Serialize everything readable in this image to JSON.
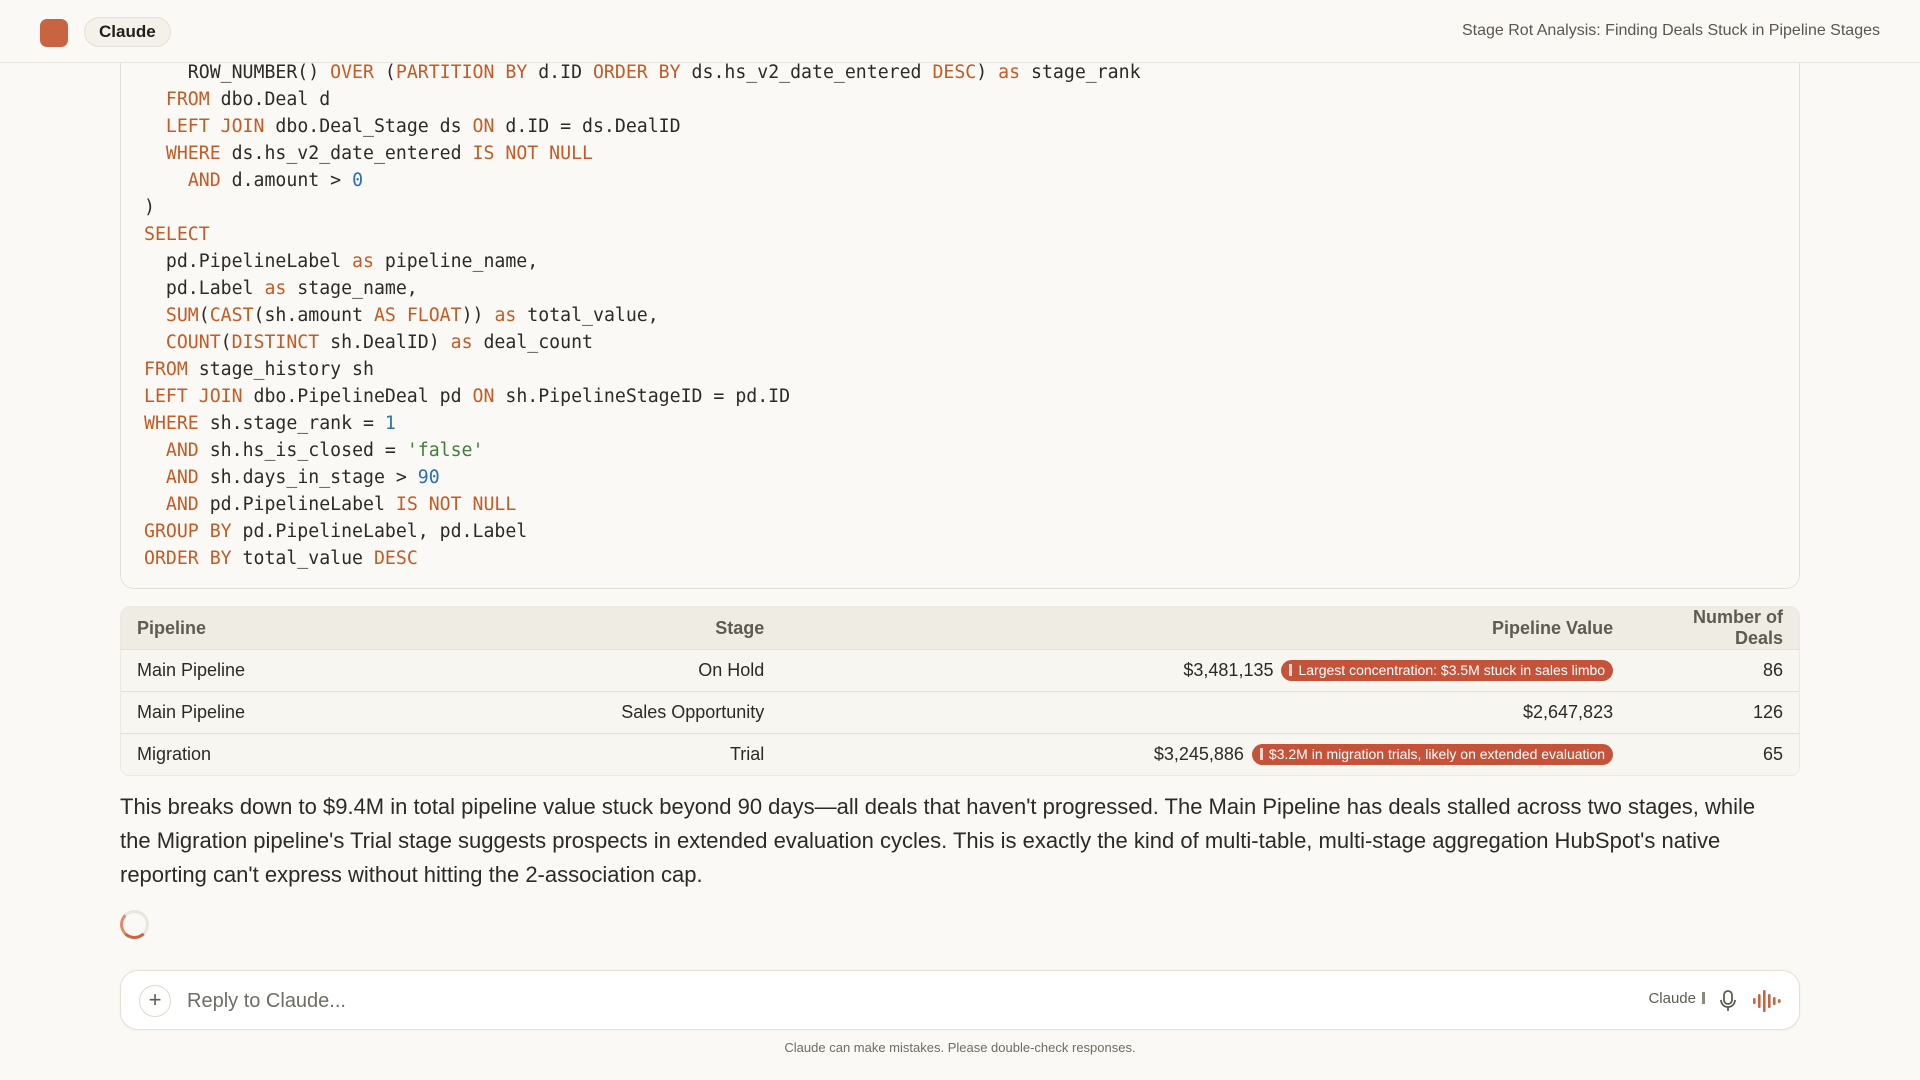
{
  "header": {
    "app_name": "Claude",
    "chat_title": "Stage Rot Analysis: Finding Deals Stuck in Pipeline Stages"
  },
  "code_lines": [
    [
      {
        "t": "    ROW_NUMBER() ",
        "c": ""
      },
      {
        "t": "OVER",
        "c": "kw"
      },
      {
        "t": " (",
        "c": ""
      },
      {
        "t": "PARTITION BY",
        "c": "kw"
      },
      {
        "t": " d.ID ",
        "c": ""
      },
      {
        "t": "ORDER BY",
        "c": "kw"
      },
      {
        "t": " ds.hs_v2_date_entered ",
        "c": ""
      },
      {
        "t": "DESC",
        "c": "kw"
      },
      {
        "t": ") ",
        "c": ""
      },
      {
        "t": "as",
        "c": "kw"
      },
      {
        "t": " stage_rank",
        "c": ""
      }
    ],
    [
      {
        "t": "  ",
        "c": ""
      },
      {
        "t": "FROM",
        "c": "kw"
      },
      {
        "t": " dbo.Deal d",
        "c": ""
      }
    ],
    [
      {
        "t": "  ",
        "c": ""
      },
      {
        "t": "LEFT JOIN",
        "c": "kw"
      },
      {
        "t": " dbo.Deal_Stage ds ",
        "c": ""
      },
      {
        "t": "ON",
        "c": "kw"
      },
      {
        "t": " d.ID = ds.DealID",
        "c": ""
      }
    ],
    [
      {
        "t": "  ",
        "c": ""
      },
      {
        "t": "WHERE",
        "c": "kw"
      },
      {
        "t": " ds.hs_v2_date_entered ",
        "c": ""
      },
      {
        "t": "IS NOT NULL",
        "c": "kw"
      }
    ],
    [
      {
        "t": "    ",
        "c": ""
      },
      {
        "t": "AND",
        "c": "kw"
      },
      {
        "t": " d.amount > ",
        "c": ""
      },
      {
        "t": "0",
        "c": "num"
      }
    ],
    [
      {
        "t": ")",
        "c": ""
      }
    ],
    [
      {
        "t": "SELECT",
        "c": "kw"
      }
    ],
    [
      {
        "t": "  pd.PipelineLabel ",
        "c": ""
      },
      {
        "t": "as",
        "c": "kw"
      },
      {
        "t": " pipeline_name,",
        "c": ""
      }
    ],
    [
      {
        "t": "  pd.Label ",
        "c": ""
      },
      {
        "t": "as",
        "c": "kw"
      },
      {
        "t": " stage_name,",
        "c": ""
      }
    ],
    [
      {
        "t": "  ",
        "c": ""
      },
      {
        "t": "SUM",
        "c": "kw"
      },
      {
        "t": "(",
        "c": ""
      },
      {
        "t": "CAST",
        "c": "kw"
      },
      {
        "t": "(sh.amount ",
        "c": ""
      },
      {
        "t": "AS FLOAT",
        "c": "kw"
      },
      {
        "t": ")) ",
        "c": ""
      },
      {
        "t": "as",
        "c": "kw"
      },
      {
        "t": " total_value,",
        "c": ""
      }
    ],
    [
      {
        "t": "  ",
        "c": ""
      },
      {
        "t": "COUNT",
        "c": "kw"
      },
      {
        "t": "(",
        "c": ""
      },
      {
        "t": "DISTINCT",
        "c": "kw"
      },
      {
        "t": " sh.DealID) ",
        "c": ""
      },
      {
        "t": "as",
        "c": "kw"
      },
      {
        "t": " deal_count",
        "c": ""
      }
    ],
    [
      {
        "t": "FROM",
        "c": "kw"
      },
      {
        "t": " stage_history sh",
        "c": ""
      }
    ],
    [
      {
        "t": "LEFT JOIN",
        "c": "kw"
      },
      {
        "t": " dbo.PipelineDeal pd ",
        "c": ""
      },
      {
        "t": "ON",
        "c": "kw"
      },
      {
        "t": " sh.PipelineStageID = pd.ID",
        "c": ""
      }
    ],
    [
      {
        "t": "WHERE",
        "c": "kw"
      },
      {
        "t": " sh.stage_rank = ",
        "c": ""
      },
      {
        "t": "1",
        "c": "num"
      }
    ],
    [
      {
        "t": "  ",
        "c": ""
      },
      {
        "t": "AND",
        "c": "kw"
      },
      {
        "t": " sh.hs_is_closed = ",
        "c": ""
      },
      {
        "t": "'false'",
        "c": "str"
      }
    ],
    [
      {
        "t": "  ",
        "c": ""
      },
      {
        "t": "AND",
        "c": "kw"
      },
      {
        "t": " sh.days_in_stage > ",
        "c": ""
      },
      {
        "t": "90",
        "c": "num"
      }
    ],
    [
      {
        "t": "  ",
        "c": ""
      },
      {
        "t": "AND",
        "c": "kw"
      },
      {
        "t": " pd.PipelineLabel ",
        "c": ""
      },
      {
        "t": "IS NOT NULL",
        "c": "kw"
      }
    ],
    [
      {
        "t": "GROUP BY",
        "c": "kw"
      },
      {
        "t": " pd.PipelineLabel, pd.Label",
        "c": ""
      }
    ],
    [
      {
        "t": "ORDER BY",
        "c": "kw"
      },
      {
        "t": " total_value ",
        "c": ""
      },
      {
        "t": "DESC",
        "c": "kw"
      }
    ]
  ],
  "table": {
    "headers": {
      "pipeline": "Pipeline",
      "stage": "Stage",
      "value": "Pipeline Value",
      "deals": "Number of Deals"
    },
    "rows": [
      {
        "pipeline": "Main Pipeline",
        "stage": "On Hold",
        "value": "$3,481,135",
        "note": "Largest concentration: $3.5M stuck in sales limbo",
        "deals": "86"
      },
      {
        "pipeline": "Main Pipeline",
        "stage": "Sales Opportunity",
        "value": "$2,647,823",
        "note": "",
        "deals": "126"
      },
      {
        "pipeline": "Migration",
        "stage": "Trial",
        "value": "$3,245,886",
        "note": "$3.2M in migration trials, likely on extended evaluation",
        "deals": "65"
      }
    ]
  },
  "summary": "This breaks down to $9.4M in total pipeline value stuck beyond 90 days—all deals that haven't progressed. The Main Pipeline has deals stalled across two stages, while the Migration pipeline's Trial stage suggests prospects in extended evaluation cycles. This is exactly the kind of multi-table, multi-stage aggregation HubSpot's native reporting can't express without hitting the 2-association cap.",
  "composer": {
    "placeholder": "Reply to Claude...",
    "model_label": "Claude"
  },
  "disclaimer": "Claude can make mistakes. Please double-check responses.",
  "colors": {
    "accent": "#c96442",
    "keyword": "#c65a24",
    "number": "#2b70b5",
    "string": "#3f7f3a",
    "badge": "#c4533a"
  },
  "icons": {
    "logo": "claude-logo-icon",
    "attach": "plus-icon",
    "mic": "microphone-icon",
    "voice": "voice-waveform-icon",
    "loading": "spinner-icon"
  }
}
